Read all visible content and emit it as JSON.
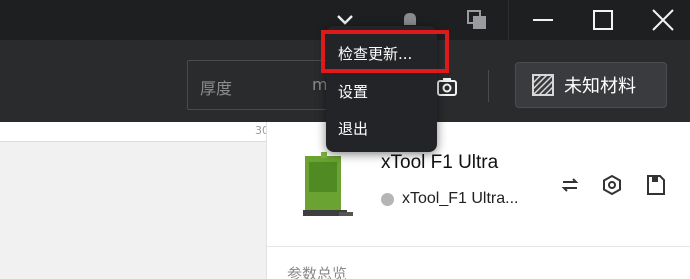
{
  "titlebar": {
    "icons": [
      "chevron-down-icon",
      "bell-icon",
      "copy-icon",
      "minimize-icon",
      "maximize-icon",
      "close-icon"
    ]
  },
  "toolbar": {
    "thickness_label": "厚度",
    "thickness_unit": "m",
    "material_label": "未知材料"
  },
  "canvas": {
    "ruler_number": "30"
  },
  "device": {
    "name": "xTool F1 Ultra",
    "sub_name": "xTool_F1 Ultra...",
    "status_color": "#b5b5b5"
  },
  "panel": {
    "section_title": "参数总览"
  },
  "menu": {
    "items": [
      {
        "label": "检查更新..."
      },
      {
        "label": "设置"
      },
      {
        "label": "退出"
      }
    ],
    "highlight_color": "#e0191d"
  }
}
